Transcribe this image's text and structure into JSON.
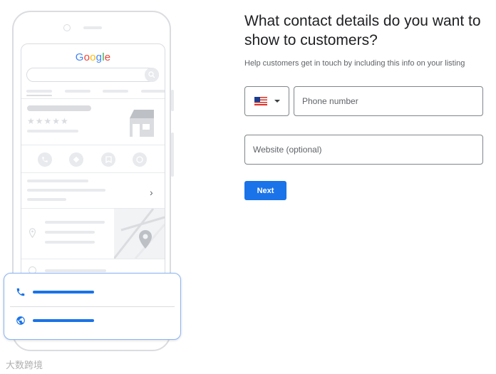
{
  "illustration": {
    "logo_letters": [
      "G",
      "o",
      "o",
      "g",
      "l",
      "e"
    ],
    "stars": "★★★★★",
    "chevron": "›",
    "card_icons": [
      "phone-icon",
      "globe-icon"
    ]
  },
  "form": {
    "title": "What contact details do you want to show to customers?",
    "subtitle": "Help customers get in touch by including this info on your listing",
    "country_select": {
      "selected": "US",
      "icon": "us-flag-icon"
    },
    "phone": {
      "placeholder": "Phone number",
      "value": ""
    },
    "website": {
      "placeholder": "Website (optional)",
      "value": ""
    },
    "next_label": "Next"
  },
  "watermark": "大数跨境",
  "colors": {
    "accent": "#1a73e8",
    "text": "#202124",
    "muted": "#5f6368",
    "border": "#80868b",
    "illustration_gray": "#dadce0"
  }
}
